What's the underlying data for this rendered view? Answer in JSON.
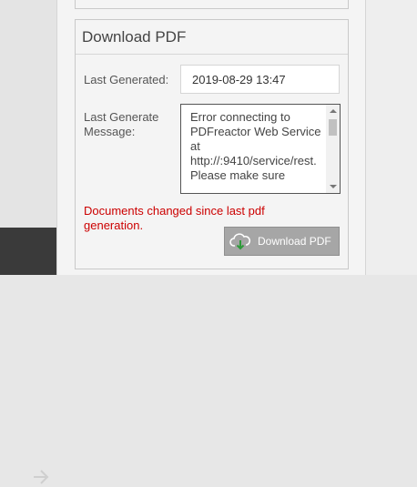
{
  "panel": {
    "title": "Download PDF",
    "last_generated_label": "Last Generated:",
    "last_generated_value": "2019-08-29 13:47",
    "message_label_line1": "Last Generate",
    "message_label_line2": "Message:",
    "message_text": "Error connecting to PDFreactor Web Service at http://:9410/service/rest. Please make sure",
    "warning_text": "Documents changed since last pdf generation.",
    "download_button_label": "Download PDF"
  },
  "icons": {
    "arrow": "arrow-right-icon",
    "cloud": "cloud-download-icon"
  },
  "colors": {
    "warning": "#cc0000",
    "button_bg": "#a6a6a6",
    "cloud_arrow": "#2e9a3a"
  }
}
